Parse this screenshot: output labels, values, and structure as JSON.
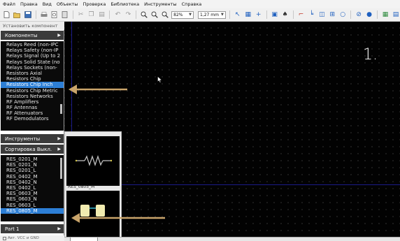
{
  "menu": {
    "items": [
      "Файл",
      "Правка",
      "Вид",
      "Объекты",
      "Проверка",
      "Библиотека",
      "Инструменты",
      "Справка"
    ]
  },
  "toolbar": {
    "zoom_value": "82%",
    "units_value": "1,27 mm"
  },
  "left_panel": {
    "install_component_label": "Установить компонент",
    "components_header": "Компоненты",
    "component_categories": [
      "Relays Reed (non-IPC",
      "Relays Safety (non-IP",
      "Relays Signal (Up to 2",
      "Relays Solid State (no",
      "Relays Sockets (non-",
      "Resistors Axial",
      "Resistors Chip",
      "Resistors Chip Inch",
      "Resistors Chip Metric",
      "Resistors Networks",
      "RF Amplifiers",
      "RF Antennas",
      "RF Attenuators",
      "RF Demodulators"
    ],
    "selected_category": "Resistors Chip Inch",
    "tools_header": "Инструменты",
    "sort_header": "Сортировка Выкл.",
    "parts": [
      "RES_0201_M",
      "RES_0201_N",
      "RES_0201_L",
      "RES_0402_M",
      "RES_0402_N",
      "RES_0402_L",
      "RES_0603_M",
      "RES_0603_N",
      "RES_0603_L",
      "RES_0805_M"
    ],
    "selected_part": "RES_0805_M",
    "part_header": "Part 1",
    "bottom_label": "Авт. VCC и GND"
  },
  "preview": {
    "part_name": "RES_0805_M"
  },
  "annotation": {
    "number": "1."
  },
  "colors": {
    "canvas_bg": "#020202",
    "grid_dot": "#5a5a5a",
    "axis": "#1b1b8a",
    "selection": "#2d7fd6",
    "arrow": "#c9a46a",
    "panel_dark": "#3b3b3b",
    "pad_yellow": "#f2ecb0"
  },
  "icons": [
    "new-file-icon",
    "open-icon",
    "save-icon",
    "print-icon",
    "print-preview-icon",
    "export-icon",
    "cut-icon",
    "copy-icon",
    "paste-icon",
    "undo-icon",
    "redo-icon",
    "zoom-in-icon",
    "zoom-out-icon",
    "zoom-fit-icon",
    "select-icon",
    "component-icon",
    "add-icon",
    "layer-icon",
    "find-icon",
    "route-icon",
    "drc-icon"
  ]
}
